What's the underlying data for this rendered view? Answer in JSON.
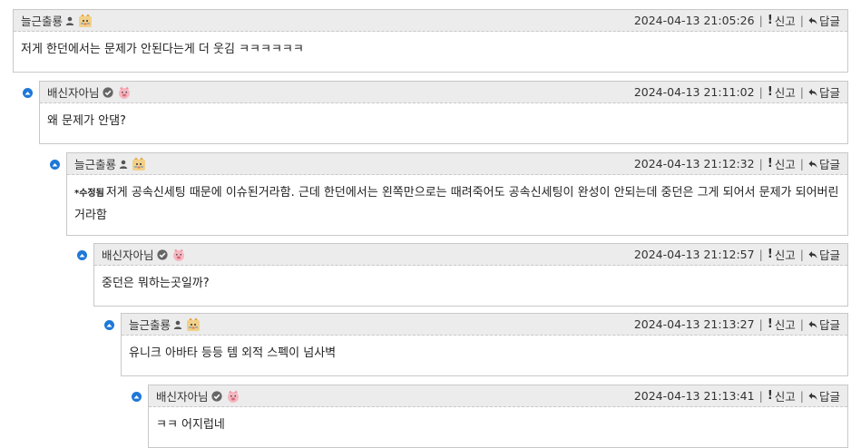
{
  "actions": {
    "report": "신고",
    "reply": "답글"
  },
  "comments": [
    {
      "author": "늘근출룡",
      "role": "person-icon",
      "avatar": "tiger-avatar-icon",
      "date": "2024-04-13 21:05:26",
      "edited_tag": "",
      "text": "저게 한던에서는 문제가 안된다는게 더 웃김 ㅋㅋㅋㅋㅋㅋ"
    },
    {
      "author": "배신자아님",
      "role": "verified-check-icon",
      "avatar": "pig-avatar-icon",
      "date": "2024-04-13 21:11:02",
      "edited_tag": "",
      "text": "왜 문제가 안댐?"
    },
    {
      "author": "늘근출룡",
      "role": "person-icon",
      "avatar": "tiger-avatar-icon",
      "date": "2024-04-13 21:12:32",
      "edited_tag": "*수정됨",
      "text": "저게 공속신세팅 때문에 이슈된거라함. 근데 한던에서는 왼쪽만으로는 때려죽어도 공속신세팅이 완성이 안되는데 중던은 그게 되어서 문제가 되어버린거라함"
    },
    {
      "author": "배신자아님",
      "role": "verified-check-icon",
      "avatar": "pig-avatar-icon",
      "date": "2024-04-13 21:12:57",
      "edited_tag": "",
      "text": "중던은 뭐하는곳일까?"
    },
    {
      "author": "늘근출룡",
      "role": "person-icon",
      "avatar": "tiger-avatar-icon",
      "date": "2024-04-13 21:13:27",
      "edited_tag": "",
      "text": "유니크 아바타 등등 템 외적 스펙이 넘사벽"
    },
    {
      "author": "배신자아님",
      "role": "verified-check-icon",
      "avatar": "pig-avatar-icon",
      "date": "2024-04-13 21:13:41",
      "edited_tag": "",
      "text": "ㅋㅋ 어지럽네"
    }
  ]
}
